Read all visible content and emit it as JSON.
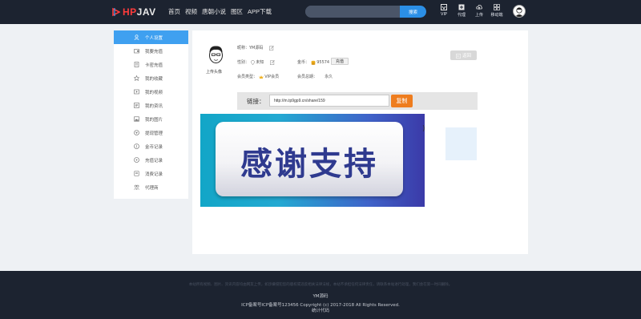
{
  "header": {
    "logo_hp": "HP",
    "logo_jav": "JAV",
    "nav": [
      "首页",
      "视频",
      "唐朝小说",
      "图区",
      "APP下载"
    ],
    "search_placeholder": "",
    "search_button": "搜索",
    "icons": [
      {
        "label": "VIP",
        "icon": "vip-icon"
      },
      {
        "label": "代理",
        "icon": "agent-icon"
      },
      {
        "label": "上传",
        "icon": "upload-icon"
      },
      {
        "label": "移动端",
        "icon": "mobile-icon"
      }
    ]
  },
  "sidebar": {
    "items": [
      {
        "label": "个人设置",
        "icon": "user-icon",
        "active": true
      },
      {
        "label": "我要充值",
        "icon": "wallet-icon"
      },
      {
        "label": "卡密充值",
        "icon": "card-icon"
      },
      {
        "label": "我的收藏",
        "icon": "star-icon"
      },
      {
        "label": "我的视频",
        "icon": "video-icon"
      },
      {
        "label": "我的资讯",
        "icon": "news-icon"
      },
      {
        "label": "我的图片",
        "icon": "image-icon"
      },
      {
        "label": "提现管理",
        "icon": "withdraw-icon"
      },
      {
        "label": "金币记录",
        "icon": "coin-icon"
      },
      {
        "label": "充值记录",
        "icon": "recharge-icon"
      },
      {
        "label": "消费记录",
        "icon": "consume-icon"
      },
      {
        "label": "代理商",
        "icon": "agent-icon"
      }
    ]
  },
  "profile": {
    "avatar_caption": "上传头像",
    "nickname": "昵称：YM源码",
    "gender_label": "性别：",
    "gender_value": "未知",
    "coins_label": "金币：",
    "coins_value": "95574",
    "recharge_button": "充值",
    "member_type_label": "会员类型：",
    "member_type_value": "VIP会员",
    "member_expire_label": "会员总期：",
    "member_expire_value": "永久",
    "return_button": "返回"
  },
  "share": {
    "label": "链接：",
    "url": "http://m.tp9gp9.cn/share/159",
    "copy_button": "复制"
  },
  "banner": {
    "text": "感谢支持",
    "trailing_text": ")"
  },
  "footer": {
    "disclaimer": "本站所有视频、图片、资讯内容均由网友上传，如涉嫌侵犯您的版权或违反相关法律法规，本站不承担任何法律责任，请联系本站进行处理，我们会在第一时间删除。",
    "site_name": "YM源码",
    "icp": "ICP备案号ICP备案号123456    Copyright (c) 2017-2018 All Rights Reserved.",
    "stats": "统计代码"
  },
  "colors": {
    "header_bg": "#1c2330",
    "accent": "#3fa0f0",
    "copy_button": "#ee7d1f",
    "logo_red": "#ff3b3b"
  }
}
